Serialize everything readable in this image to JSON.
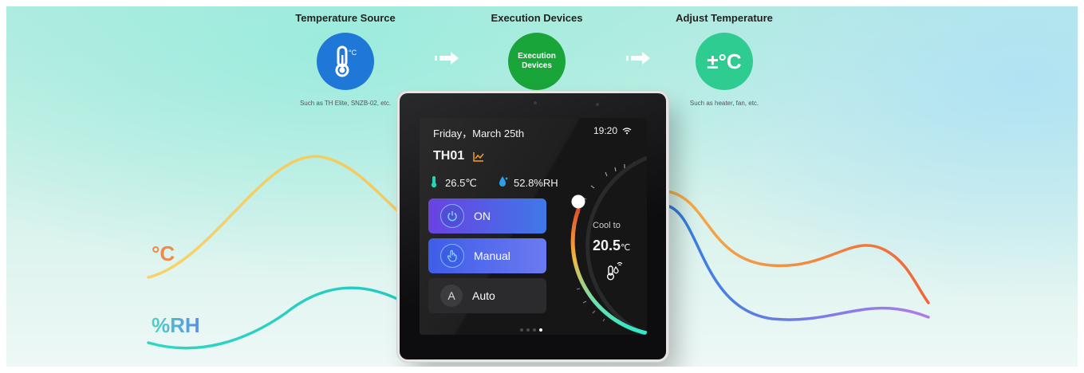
{
  "steps": [
    {
      "title": "Temperature Source",
      "icon": "thermometer-celsius-icon",
      "color": "#1f78d8",
      "subtitle": "Such as  TH Elite, SNZB-02, etc."
    },
    {
      "title": "Execution Devices",
      "icon_text": "Execution Devices",
      "color": "#1aa53a",
      "subtitle": ""
    },
    {
      "title": "Adjust Temperature",
      "icon_text": "±°C",
      "color": "#2fcc92",
      "subtitle": "Such as heater, fan, etc."
    }
  ],
  "labels": {
    "celsius": "°C",
    "humidity": "%RH"
  },
  "colors": {
    "celsius": "#f08a4a",
    "humidity": "#4aa8e0",
    "ui_accent": "#2fe8c8"
  },
  "device": {
    "date": "Friday，March 25th",
    "time": "19:20",
    "sensor_name": "TH01",
    "temperature": "26.5℃",
    "humidity": "52.8%RH",
    "modes": [
      {
        "label": "ON",
        "icon": "power-icon"
      },
      {
        "label": "Manual",
        "icon": "hand-icon"
      },
      {
        "label": "Auto",
        "icon_text": "A"
      }
    ],
    "dial": {
      "caption": "Cool to",
      "value": "20.5",
      "unit": "℃"
    },
    "pager": {
      "count": 4,
      "active": 3
    }
  }
}
